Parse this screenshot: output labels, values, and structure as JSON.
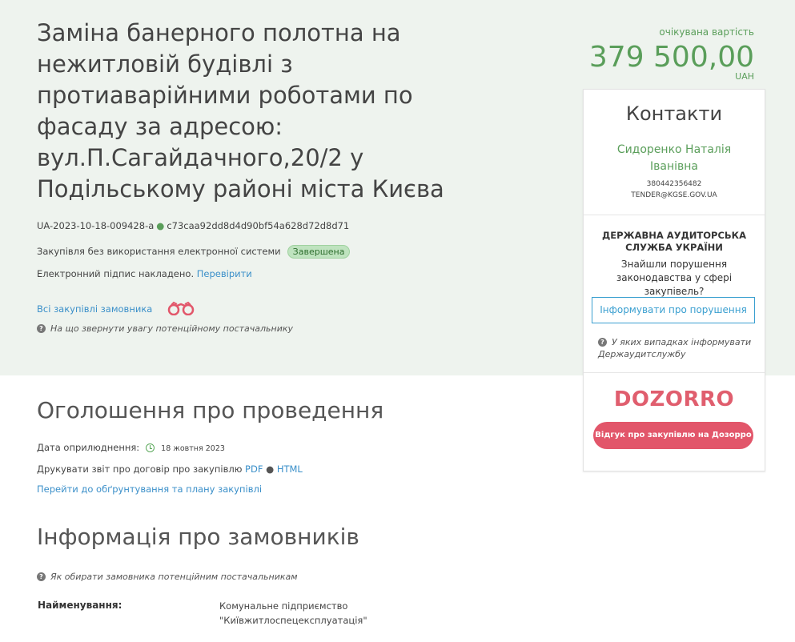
{
  "tender": {
    "title": "Заміна банерного полотна на нежитловій будівлі з протиаварійними роботами по фасаду за адресою: вул.П.Сагайдачного,20/2 у Подільському районі міста Києва",
    "id": "UA-2023-10-18-009428-a",
    "hash": "c73caa92dd8d4d90bf54a628d72d8d71",
    "procurement_type": "Закупівля без використання електронної системи",
    "status": "Завершена",
    "signature_text": "Електронний підпис накладено.",
    "signature_link": "Перевірити",
    "all_purchases_link": "Всі закупівлі замовника",
    "supplier_hint": "На що звернути увагу потенційному постачальнику"
  },
  "price": {
    "label": "очікувана вартість",
    "amount": "379 500,00",
    "currency": "UAH"
  },
  "contacts": {
    "title": "Контакти",
    "name": "Сидоренко Наталія Іванівна",
    "phone": "380442356482",
    "email": "TENDER@KGSE.GOV.UA"
  },
  "dasu": {
    "title": "ДЕРЖАВНА АУДИТОРСЬКА СЛУЖБА УКРАЇНИ",
    "text": "Знайшли порушення законодавства у сфері закупівель?",
    "button": "Інформувати про порушення",
    "hint": "У яких випадках інформувати Держаудитслужбу"
  },
  "dozorro": {
    "logo": "DOZORRO",
    "button": "Відгук про закупівлю на Дозорро"
  },
  "announcement": {
    "heading": "Оголошення про проведення",
    "date_label": "Дата оприлюднення:",
    "date_value": "18 жовтня 2023",
    "print_text": "Друкувати звіт про договір про закупівлю",
    "pdf": "PDF",
    "html": "HTML",
    "plan_link": "Перейти до обґрунтування та плану закупівлі"
  },
  "customers": {
    "heading": "Інформація про замовників",
    "hint": "Як обирати замовника потенційним постачальникам",
    "name_label": "Найменування:",
    "name_line1": "Комунальне підприємство",
    "name_line2": "\"Київжитлоспецексплуатація\""
  },
  "icons": [
    "binoculars-icon",
    "question-icon",
    "clock-icon"
  ],
  "colors": {
    "accent_green": "#5a9e5a",
    "link_blue": "#3a8fc9",
    "dozorro_red": "#e2566a",
    "hero_bg": "#eef3ee"
  }
}
